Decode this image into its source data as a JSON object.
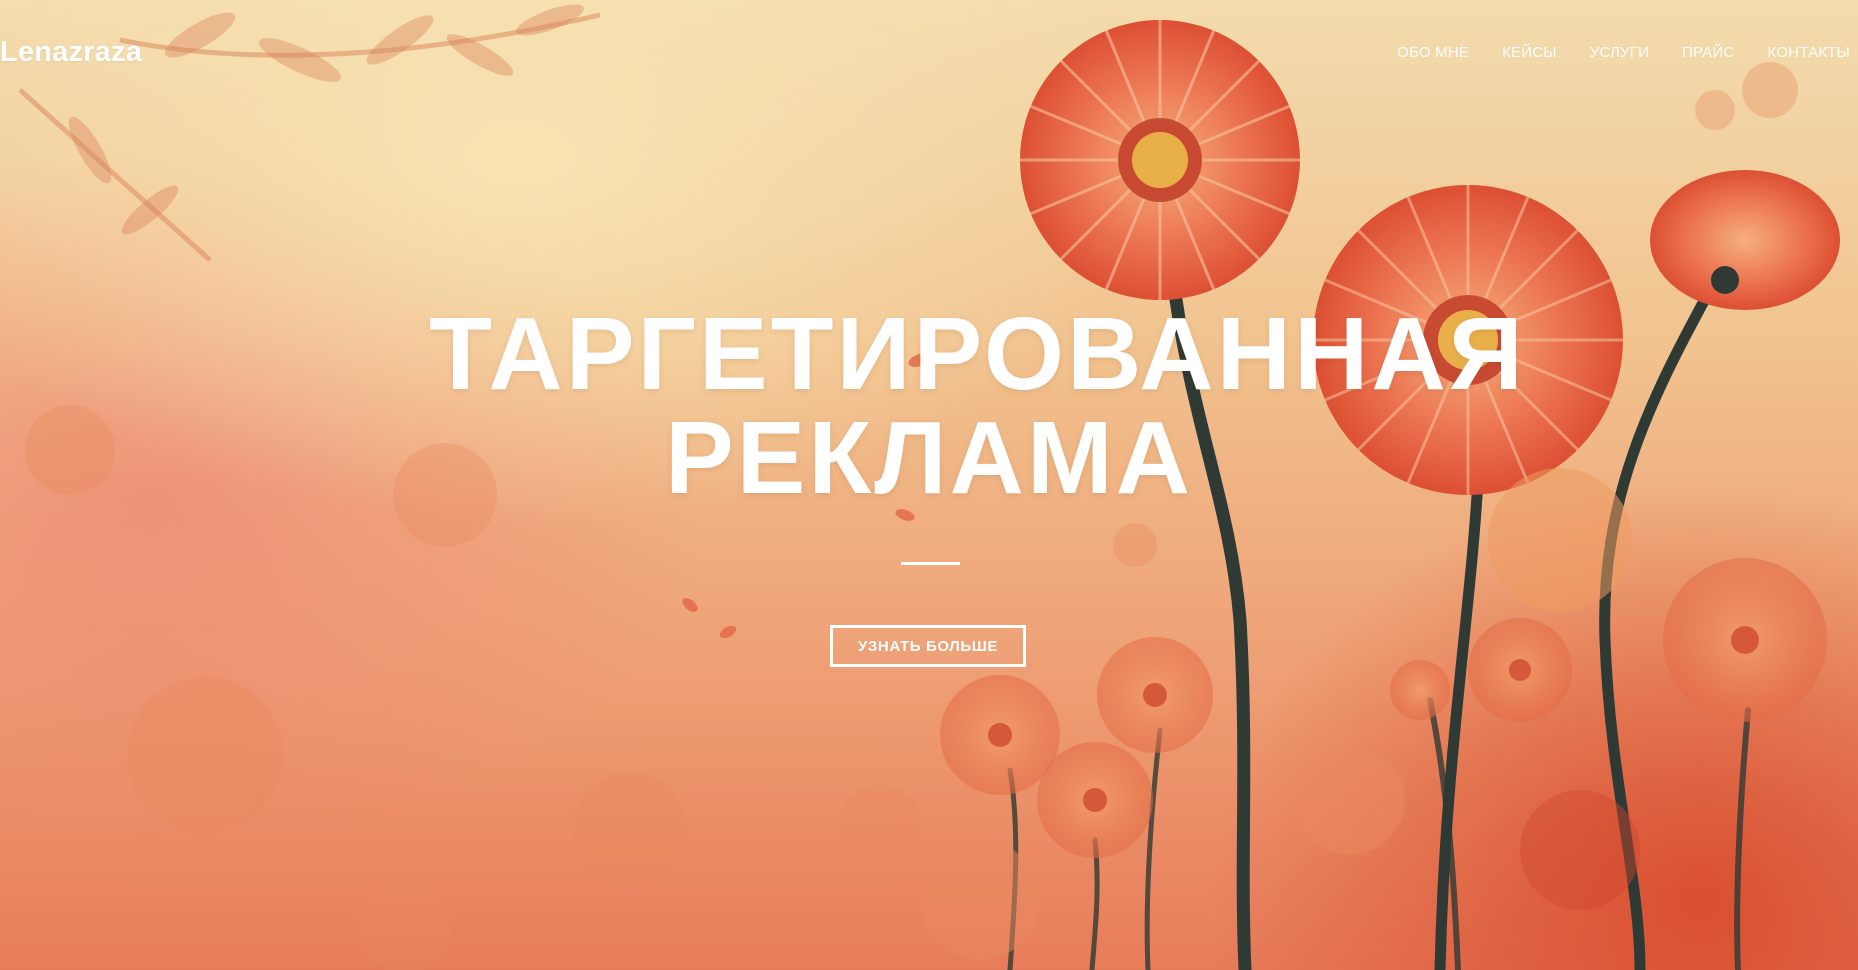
{
  "header": {
    "logo": "Lenazraza",
    "nav": [
      {
        "label": "ОБО МНЕ"
      },
      {
        "label": "КЕЙСЫ"
      },
      {
        "label": "УСЛУГИ"
      },
      {
        "label": "ПРАЙС"
      },
      {
        "label": "КОНТАКТЫ"
      }
    ]
  },
  "hero": {
    "title_line1": "ТАРГЕТИРОВАННАЯ",
    "title_line2": "РЕКЛАМА",
    "cta_label": "УЗНАТЬ БОЛЬШЕ",
    "background_image": "gerbera-flowers-painting"
  },
  "colors": {
    "text": "#ffffff",
    "petal": "#e8603f",
    "stem": "#2f3a34"
  }
}
